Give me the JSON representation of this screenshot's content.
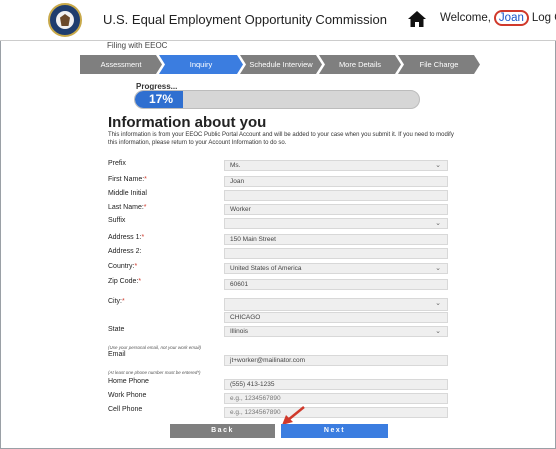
{
  "header": {
    "agency_name": "U.S. Equal Employment Opportunity Commission",
    "welcome_text": "Welcome,",
    "user_name": "Joan",
    "logout_label": "Log Out",
    "sub_title": "Filing with EEOC"
  },
  "steps": [
    {
      "label": "Assessment",
      "state": "done"
    },
    {
      "label": "Inquiry",
      "state": "active"
    },
    {
      "label": "Schedule Interview",
      "state": "todo"
    },
    {
      "label": "More Details",
      "state": "todo"
    },
    {
      "label": "File Charge",
      "state": "todo"
    }
  ],
  "progress": {
    "label": "Progress...",
    "percent_text": "17%",
    "value": 17
  },
  "form": {
    "title": "Information about you",
    "intro": "This information is from your EEOC Public Portal Account and will be added to your case when you submit it. If you need to modify this information, please return to your Account Information to do so."
  },
  "fields": {
    "prefix": {
      "label": "Prefix",
      "value": "Ms."
    },
    "first_name": {
      "label": "First Name:",
      "value": "Joan"
    },
    "middle_initial": {
      "label": "Middle Initial",
      "value": ""
    },
    "last_name": {
      "label": "Last Name:",
      "value": "Worker"
    },
    "suffix": {
      "label": "Suffix",
      "value": ""
    },
    "address1": {
      "label": "Address 1:",
      "value": "150 Main Street"
    },
    "address2": {
      "label": "Address 2:",
      "value": ""
    },
    "country": {
      "label": "Country:",
      "value": "United States of America"
    },
    "zip": {
      "label": "Zip Code:",
      "value": "60601"
    },
    "city": {
      "label": "City:",
      "value": "",
      "typed": "CHICAGO"
    },
    "state": {
      "label": "State",
      "value": "Illinois"
    },
    "email_hint": "(Use your personal email, not your work email)",
    "email": {
      "label": "Email",
      "value": "jt+worker@mailinator.com"
    },
    "phone_hint": "(At least one phone number must be entered*)",
    "home_phone": {
      "label": "Home Phone",
      "value": "(555) 413-1235"
    },
    "work_phone": {
      "label": "Work Phone",
      "placeholder": "e.g., 1234567890"
    },
    "cell_phone": {
      "label": "Cell Phone",
      "placeholder": "e.g., 1234567890"
    }
  },
  "buttons": {
    "back": "Back",
    "next": "Next"
  },
  "colors": {
    "accent": "#3b7de0",
    "step_done": "#7f7f7f",
    "required": "#d0392b",
    "highlight_circle": "#d0392b"
  },
  "icons": {
    "home": "home-icon",
    "seal": "eeoc-seal-icon",
    "dropdown": "chevron-down-icon",
    "annotation": "red-arrow-icon"
  }
}
